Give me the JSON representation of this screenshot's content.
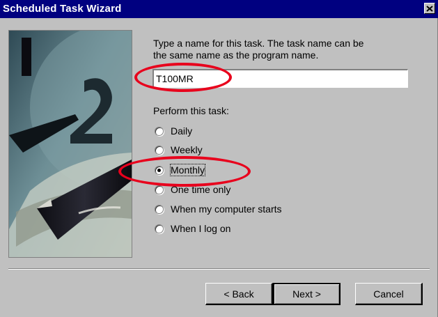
{
  "window": {
    "title": "Scheduled Task Wizard",
    "close_glyph": "✕"
  },
  "prompt": {
    "line1": "Type a name for this task.  The task name can be",
    "line2": "the same name as the program name."
  },
  "task_name": {
    "value": "T100MR"
  },
  "perform": {
    "label": "Perform this task:",
    "options": [
      {
        "label": "Daily",
        "checked": false
      },
      {
        "label": "Weekly",
        "checked": false
      },
      {
        "label": "Monthly",
        "checked": true
      },
      {
        "label": "One time only",
        "checked": false
      },
      {
        "label": "When my computer starts",
        "checked": false
      },
      {
        "label": "When I log on",
        "checked": false
      }
    ]
  },
  "buttons": {
    "back": "< Back",
    "next": "Next >",
    "cancel": "Cancel"
  },
  "annotation_color": "#e8001c",
  "colors": {
    "titlebar": "#000080",
    "face": "#c0c0c0"
  }
}
